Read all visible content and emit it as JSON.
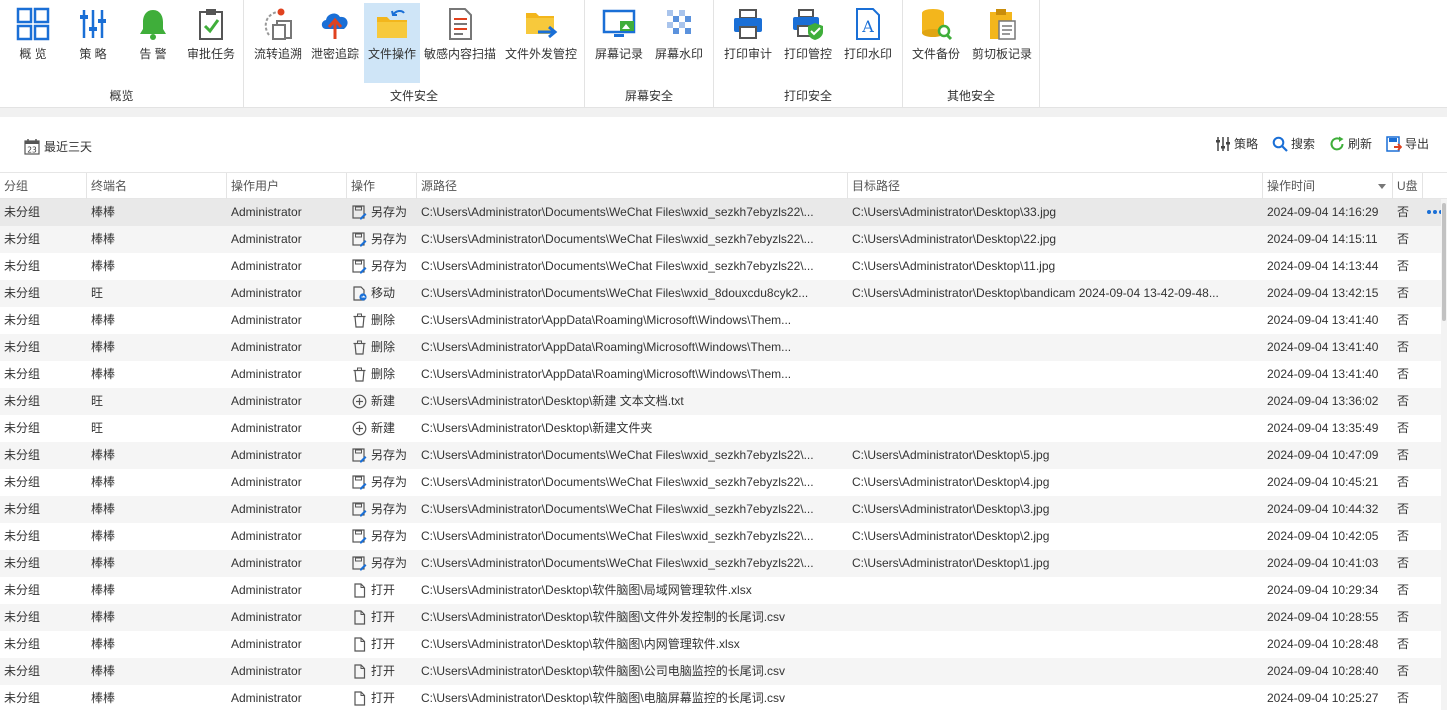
{
  "ribbon": {
    "groups": [
      {
        "label": "概览",
        "buttons": [
          {
            "label": "概 览",
            "icon": "grid-icon"
          },
          {
            "label": "策 略",
            "icon": "sliders-icon"
          },
          {
            "label": "告 警",
            "icon": "bell-icon"
          },
          {
            "label": "审批任务",
            "icon": "clipboard-check-icon"
          }
        ]
      },
      {
        "label": "文件安全",
        "buttons": [
          {
            "label": "流转追溯",
            "icon": "flow-trace-icon"
          },
          {
            "label": "泄密追踪",
            "icon": "cloud-upload-icon"
          },
          {
            "label": "文件操作",
            "icon": "folder-arrow-icon",
            "active": true
          },
          {
            "label": "敏感内容扫描",
            "icon": "document-scan-icon"
          },
          {
            "label": "文件外发管控",
            "icon": "folder-send-icon"
          }
        ]
      },
      {
        "label": "屏幕安全",
        "buttons": [
          {
            "label": "屏幕记录",
            "icon": "screen-record-icon"
          },
          {
            "label": "屏幕水印",
            "icon": "watermark-grid-icon"
          }
        ]
      },
      {
        "label": "打印安全",
        "buttons": [
          {
            "label": "打印审计",
            "icon": "printer-icon"
          },
          {
            "label": "打印管控",
            "icon": "printer-shield-icon"
          },
          {
            "label": "打印水印",
            "icon": "document-a-icon"
          }
        ]
      },
      {
        "label": "其他安全",
        "buttons": [
          {
            "label": "文件备份",
            "icon": "database-search-icon"
          },
          {
            "label": "剪切板记录",
            "icon": "clipboard-icon"
          }
        ]
      }
    ]
  },
  "toolbar": {
    "date_filter": "最近三天",
    "date_icon_text": "23",
    "strategy": "策略",
    "search": "搜索",
    "refresh": "刷新",
    "export": "导出"
  },
  "table": {
    "columns": [
      "分组",
      "终端名",
      "操作用户",
      "操作",
      "源路径",
      "目标路径",
      "操作时间",
      "U盘"
    ],
    "rows": [
      {
        "group": "未分组",
        "terminal": "棒棒",
        "user": "Administrator",
        "op": "另存为",
        "opIcon": "save-as",
        "src": "C:\\Users\\Administrator\\Documents\\WeChat Files\\wxid_sezkh7ebyzls22\\...",
        "dst": "C:\\Users\\Administrator\\Desktop\\33.jpg",
        "time": "2024-09-04 14:16:29",
        "usb": "否"
      },
      {
        "group": "未分组",
        "terminal": "棒棒",
        "user": "Administrator",
        "op": "另存为",
        "opIcon": "save-as",
        "src": "C:\\Users\\Administrator\\Documents\\WeChat Files\\wxid_sezkh7ebyzls22\\...",
        "dst": "C:\\Users\\Administrator\\Desktop\\22.jpg",
        "time": "2024-09-04 14:15:11",
        "usb": "否"
      },
      {
        "group": "未分组",
        "terminal": "棒棒",
        "user": "Administrator",
        "op": "另存为",
        "opIcon": "save-as",
        "src": "C:\\Users\\Administrator\\Documents\\WeChat Files\\wxid_sezkh7ebyzls22\\...",
        "dst": "C:\\Users\\Administrator\\Desktop\\11.jpg",
        "time": "2024-09-04 14:13:44",
        "usb": "否"
      },
      {
        "group": "未分组",
        "terminal": "旺",
        "user": "Administrator",
        "op": "移动",
        "opIcon": "move",
        "src": "C:\\Users\\Administrator\\Documents\\WeChat Files\\wxid_8douxcdu8cyk2...",
        "dst": "C:\\Users\\Administrator\\Desktop\\bandicam 2024-09-04 13-42-09-48...",
        "time": "2024-09-04 13:42:15",
        "usb": "否"
      },
      {
        "group": "未分组",
        "terminal": "棒棒",
        "user": "Administrator",
        "op": "删除",
        "opIcon": "delete",
        "src": "C:\\Users\\Administrator\\AppData\\Roaming\\Microsoft\\Windows\\Them...",
        "dst": "",
        "time": "2024-09-04 13:41:40",
        "usb": "否"
      },
      {
        "group": "未分组",
        "terminal": "棒棒",
        "user": "Administrator",
        "op": "删除",
        "opIcon": "delete",
        "src": "C:\\Users\\Administrator\\AppData\\Roaming\\Microsoft\\Windows\\Them...",
        "dst": "",
        "time": "2024-09-04 13:41:40",
        "usb": "否"
      },
      {
        "group": "未分组",
        "terminal": "棒棒",
        "user": "Administrator",
        "op": "删除",
        "opIcon": "delete",
        "src": "C:\\Users\\Administrator\\AppData\\Roaming\\Microsoft\\Windows\\Them...",
        "dst": "",
        "time": "2024-09-04 13:41:40",
        "usb": "否"
      },
      {
        "group": "未分组",
        "terminal": "旺",
        "user": "Administrator",
        "op": "新建",
        "opIcon": "create",
        "src": "C:\\Users\\Administrator\\Desktop\\新建 文本文档.txt",
        "dst": "",
        "time": "2024-09-04 13:36:02",
        "usb": "否"
      },
      {
        "group": "未分组",
        "terminal": "旺",
        "user": "Administrator",
        "op": "新建",
        "opIcon": "create",
        "src": "C:\\Users\\Administrator\\Desktop\\新建文件夹",
        "dst": "",
        "time": "2024-09-04 13:35:49",
        "usb": "否"
      },
      {
        "group": "未分组",
        "terminal": "棒棒",
        "user": "Administrator",
        "op": "另存为",
        "opIcon": "save-as",
        "src": "C:\\Users\\Administrator\\Documents\\WeChat Files\\wxid_sezkh7ebyzls22\\...",
        "dst": "C:\\Users\\Administrator\\Desktop\\5.jpg",
        "time": "2024-09-04 10:47:09",
        "usb": "否"
      },
      {
        "group": "未分组",
        "terminal": "棒棒",
        "user": "Administrator",
        "op": "另存为",
        "opIcon": "save-as",
        "src": "C:\\Users\\Administrator\\Documents\\WeChat Files\\wxid_sezkh7ebyzls22\\...",
        "dst": "C:\\Users\\Administrator\\Desktop\\4.jpg",
        "time": "2024-09-04 10:45:21",
        "usb": "否"
      },
      {
        "group": "未分组",
        "terminal": "棒棒",
        "user": "Administrator",
        "op": "另存为",
        "opIcon": "save-as",
        "src": "C:\\Users\\Administrator\\Documents\\WeChat Files\\wxid_sezkh7ebyzls22\\...",
        "dst": "C:\\Users\\Administrator\\Desktop\\3.jpg",
        "time": "2024-09-04 10:44:32",
        "usb": "否"
      },
      {
        "group": "未分组",
        "terminal": "棒棒",
        "user": "Administrator",
        "op": "另存为",
        "opIcon": "save-as",
        "src": "C:\\Users\\Administrator\\Documents\\WeChat Files\\wxid_sezkh7ebyzls22\\...",
        "dst": "C:\\Users\\Administrator\\Desktop\\2.jpg",
        "time": "2024-09-04 10:42:05",
        "usb": "否"
      },
      {
        "group": "未分组",
        "terminal": "棒棒",
        "user": "Administrator",
        "op": "另存为",
        "opIcon": "save-as",
        "src": "C:\\Users\\Administrator\\Documents\\WeChat Files\\wxid_sezkh7ebyzls22\\...",
        "dst": "C:\\Users\\Administrator\\Desktop\\1.jpg",
        "time": "2024-09-04 10:41:03",
        "usb": "否"
      },
      {
        "group": "未分组",
        "terminal": "棒棒",
        "user": "Administrator",
        "op": "打开",
        "opIcon": "open",
        "src": "C:\\Users\\Administrator\\Desktop\\软件脑图\\局域网管理软件.xlsx",
        "dst": "",
        "time": "2024-09-04 10:29:34",
        "usb": "否"
      },
      {
        "group": "未分组",
        "terminal": "棒棒",
        "user": "Administrator",
        "op": "打开",
        "opIcon": "open",
        "src": "C:\\Users\\Administrator\\Desktop\\软件脑图\\文件外发控制的长尾词.csv",
        "dst": "",
        "time": "2024-09-04 10:28:55",
        "usb": "否"
      },
      {
        "group": "未分组",
        "terminal": "棒棒",
        "user": "Administrator",
        "op": "打开",
        "opIcon": "open",
        "src": "C:\\Users\\Administrator\\Desktop\\软件脑图\\内网管理软件.xlsx",
        "dst": "",
        "time": "2024-09-04 10:28:48",
        "usb": "否"
      },
      {
        "group": "未分组",
        "terminal": "棒棒",
        "user": "Administrator",
        "op": "打开",
        "opIcon": "open",
        "src": "C:\\Users\\Administrator\\Desktop\\软件脑图\\公司电脑监控的长尾词.csv",
        "dst": "",
        "time": "2024-09-04 10:28:40",
        "usb": "否"
      },
      {
        "group": "未分组",
        "terminal": "棒棒",
        "user": "Administrator",
        "op": "打开",
        "opIcon": "open",
        "src": "C:\\Users\\Administrator\\Desktop\\软件脑图\\电脑屏幕监控的长尾词.csv",
        "dst": "",
        "time": "2024-09-04 10:25:27",
        "usb": "否"
      }
    ]
  },
  "colors": {
    "accent": "#1a6fd6",
    "active_bg": "#cfe5f7",
    "folder": "#f3b61c",
    "alert_green": "#3fae3a"
  }
}
